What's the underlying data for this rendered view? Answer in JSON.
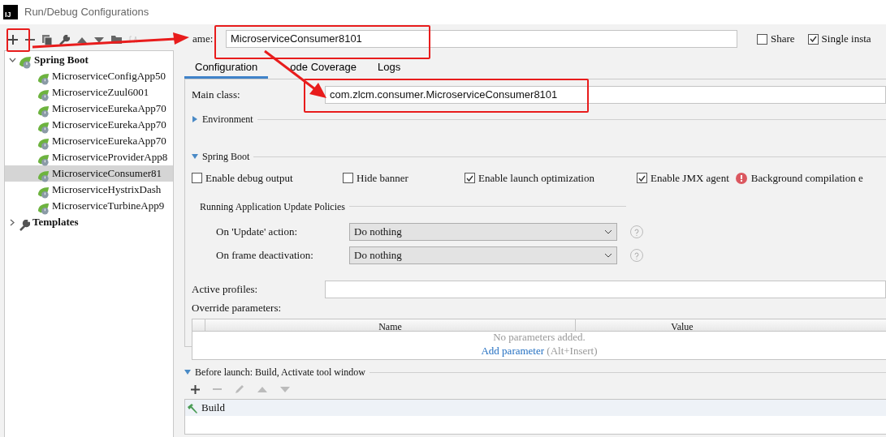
{
  "window": {
    "title": "Run/Debug Configurations",
    "logo": "IJ"
  },
  "tree": [
    {
      "label": "Spring Boot",
      "expanded": true,
      "children": [
        {
          "label": "MicroserviceConfigApp50",
          "selected": false
        },
        {
          "label": "MicroserviceZuul6001",
          "selected": false
        },
        {
          "label": "MicroserviceEurekaApp70",
          "selected": false
        },
        {
          "label": "MicroserviceEurekaApp70",
          "selected": false
        },
        {
          "label": "MicroserviceEurekaApp70",
          "selected": false
        },
        {
          "label": "MicroserviceProviderApp8",
          "selected": false
        },
        {
          "label": "MicroserviceConsumer81",
          "selected": true
        },
        {
          "label": "MicroserviceHystrixDash",
          "selected": false
        },
        {
          "label": "MicroserviceTurbineApp9",
          "selected": false
        }
      ]
    },
    {
      "label": "Templates",
      "expanded": false
    }
  ],
  "name_field": {
    "label": "ame:",
    "value": "MicroserviceConsumer8101"
  },
  "header_options": [
    {
      "label": "Share",
      "checked": false
    },
    {
      "label": "Single insta",
      "checked": true
    }
  ],
  "tabs": [
    {
      "label": "Configuration",
      "selected": true
    },
    {
      "label": "ode Coverage",
      "selected": false
    },
    {
      "label": "Logs",
      "selected": false
    }
  ],
  "main_class": {
    "label": "Main class:",
    "value": "com.zlcm.consumer.MicroserviceConsumer8101"
  },
  "environment": {
    "label": "Environment",
    "expanded": false
  },
  "spring_boot": {
    "label": "Spring Boot",
    "expanded": true,
    "options": [
      {
        "label": "Enable debug output",
        "checked": false
      },
      {
        "label": "Hide banner",
        "checked": false
      },
      {
        "label": "Enable launch optimization",
        "checked": true
      },
      {
        "label": "Enable JMX agent",
        "checked": true
      }
    ],
    "warning": "Background compilation e"
  },
  "update_policies": {
    "title": "Running Application Update Policies",
    "rows": [
      {
        "label": "On 'Update' action:",
        "value": "Do nothing"
      },
      {
        "label": "On frame deactivation:",
        "value": "Do nothing"
      }
    ]
  },
  "active_profiles": {
    "label": "Active profiles:"
  },
  "override_parameters": {
    "label": "Override parameters:",
    "columns": [
      "Name",
      "Value"
    ],
    "empty_text": "No parameters added.",
    "add_link": "Add parameter",
    "shortcut": "(Alt+Insert)"
  },
  "before_launch": {
    "label": "Before launch: Build, Activate tool window",
    "expanded": true,
    "tasks": [
      "Build"
    ]
  }
}
